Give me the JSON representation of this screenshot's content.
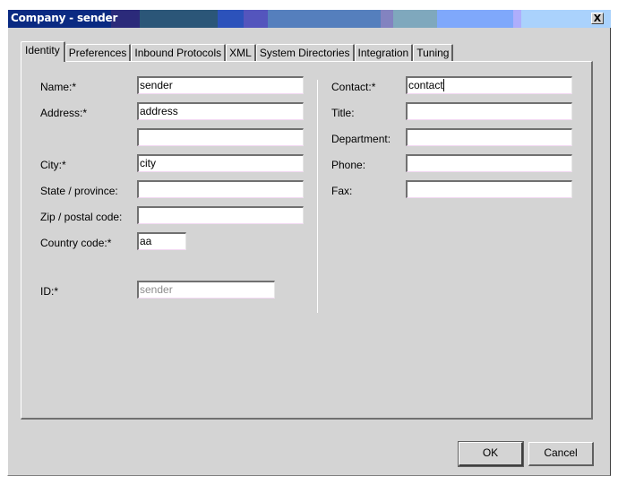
{
  "window": {
    "title": "Company - sender",
    "close_label": "X",
    "titlebar_colors": [
      "#0a2a82",
      "#2b2a7a",
      "#2b5678",
      "#2b5678",
      "#2c52bb",
      "#5455bd",
      "#557fbd",
      "#557fbd",
      "#8383c0",
      "#7fa8bd",
      "#7fa8fb",
      "#aeaefc",
      "#aad2fc"
    ]
  },
  "tabs": [
    {
      "label": "Identity",
      "active": true
    },
    {
      "label": "Preferences",
      "active": false
    },
    {
      "label": "Inbound Protocols",
      "active": false
    },
    {
      "label": "XML",
      "active": false
    },
    {
      "label": "System Directories",
      "active": false
    },
    {
      "label": "Integration",
      "active": false
    },
    {
      "label": "Tuning",
      "active": false
    }
  ],
  "form": {
    "left": {
      "name": {
        "label": "Name:*",
        "value": "sender"
      },
      "address": {
        "label": "Address:*",
        "value": "address"
      },
      "address2": {
        "label": "",
        "value": ""
      },
      "city": {
        "label": "City:*",
        "value": "city"
      },
      "state": {
        "label": "State / province:",
        "value": ""
      },
      "zip": {
        "label": "Zip / postal code:",
        "value": ""
      },
      "country": {
        "label": "Country code:*",
        "value": "aa"
      },
      "id": {
        "label": "ID:*",
        "value": "sender"
      }
    },
    "right": {
      "contact": {
        "label": "Contact:*",
        "value": "contact"
      },
      "title": {
        "label": "Title:",
        "value": ""
      },
      "department": {
        "label": "Department:",
        "value": ""
      },
      "phone": {
        "label": "Phone:",
        "value": ""
      },
      "fax": {
        "label": "Fax:",
        "value": ""
      }
    }
  },
  "buttons": {
    "ok": "OK",
    "cancel": "Cancel"
  }
}
